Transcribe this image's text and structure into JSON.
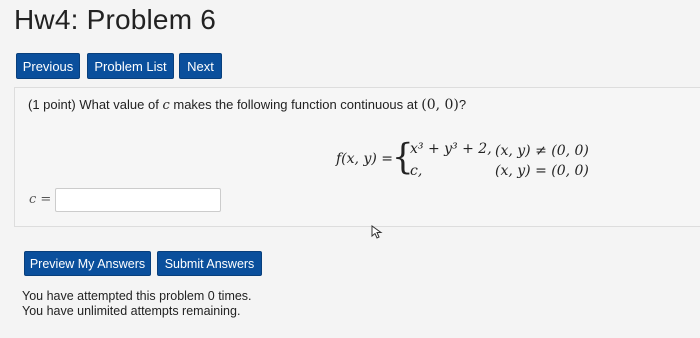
{
  "page_title": "Hw4: Problem 6",
  "nav": {
    "previous": "Previous",
    "problem_list": "Problem List",
    "next": "Next"
  },
  "problem": {
    "points": "(1 point)",
    "text_before": "What value of",
    "variable": "c",
    "text_after": "makes the following function continuous at",
    "point": "(0, 0)",
    "qmark": "?",
    "function": {
      "lhs": "f(x, y) =",
      "case1_expr": "x³ + y³ + 2,",
      "case1_cond": "(x, y) ≠ (0, 0)",
      "case2_expr": "c,",
      "case2_cond": "(x, y) = (0, 0)"
    }
  },
  "answer": {
    "label": "c =",
    "value": ""
  },
  "actions": {
    "preview": "Preview My Answers",
    "submit": "Submit Answers"
  },
  "status": {
    "attempts": "You have attempted this problem 0 times.",
    "remaining": "You have unlimited attempts remaining."
  }
}
